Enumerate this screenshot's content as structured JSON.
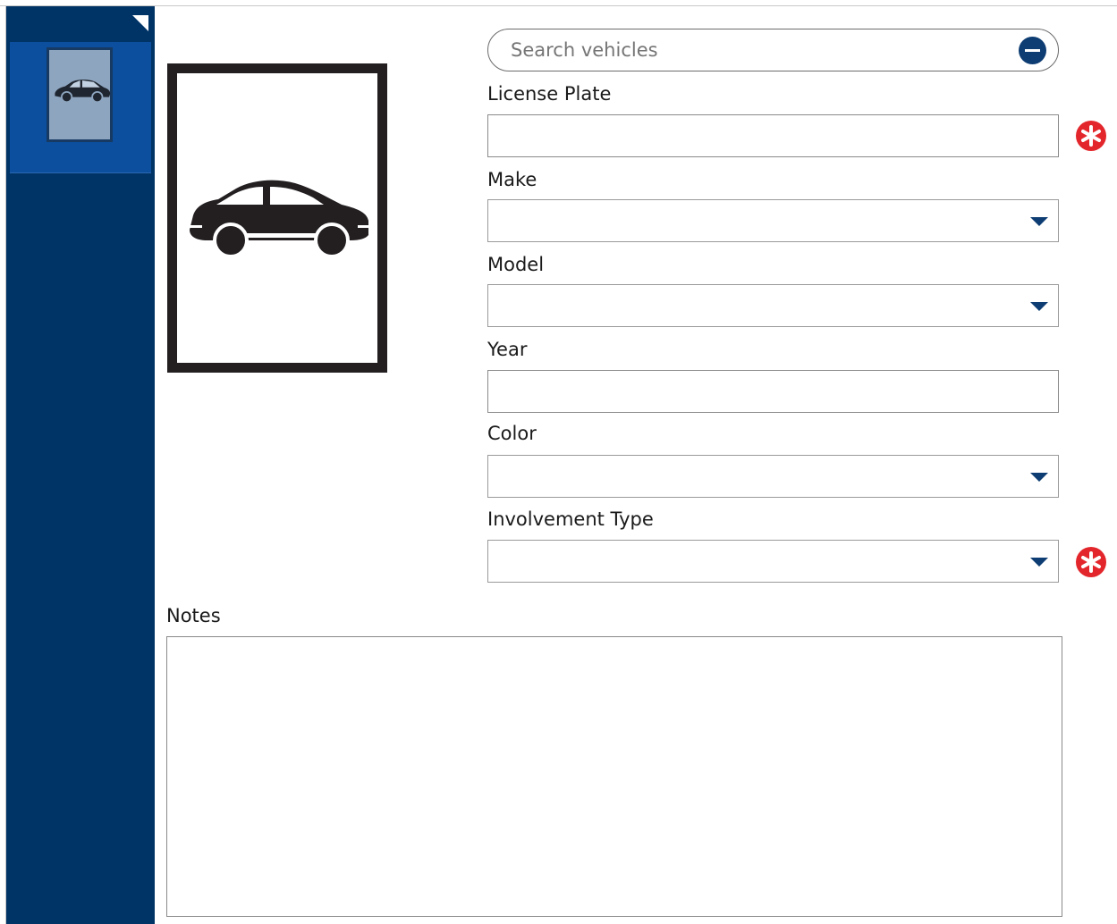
{
  "search": {
    "placeholder": "Search vehicles"
  },
  "form": {
    "license_plate_label": "License Plate",
    "make_label": "Make",
    "model_label": "Model",
    "year_label": "Year",
    "color_label": "Color",
    "involvement_type_label": "Involvement Type",
    "notes_label": "Notes"
  },
  "colors": {
    "sidebar": "#003366",
    "sidebar_selected": "#0b4f9e",
    "accent": "#0e3d73",
    "required": "#e3262b"
  },
  "icons": {
    "vehicle": "car-icon",
    "search_action": "minus-circle-icon",
    "required": "required-asterisk-icon",
    "dropdown": "chevron-down-icon"
  }
}
